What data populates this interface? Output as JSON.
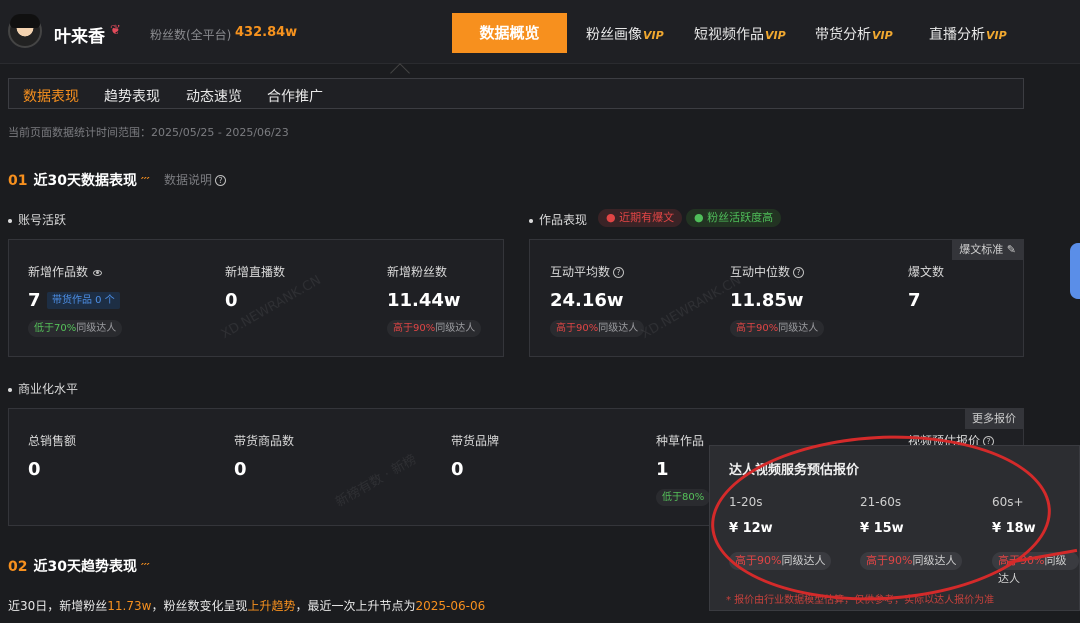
{
  "header": {
    "username": "叶来香",
    "fans_label": "粉丝数(全平台)",
    "fans_value": "432.84w",
    "nav": [
      {
        "label": "数据概览",
        "vip": ""
      },
      {
        "label": "粉丝画像",
        "vip": "VIP"
      },
      {
        "label": "短视频作品",
        "vip": "VIP"
      },
      {
        "label": "带货分析",
        "vip": "VIP"
      },
      {
        "label": "直播分析",
        "vip": "VIP"
      }
    ]
  },
  "tabs": [
    "数据表现",
    "趋势表现",
    "动态速览",
    "合作推广"
  ],
  "date_range": "当前页面数据统计时间范围：2025/05/25 - 2025/06/23",
  "section1": {
    "num": "01",
    "title": "近30天数据表现",
    "note": "数据说明"
  },
  "account": {
    "title": "账号活跃",
    "metrics": [
      {
        "label": "新增作品数",
        "value": "7",
        "tag": "带货作品 0 个",
        "compare_prefix": "低于70%",
        "compare_suffix": "同级达人"
      },
      {
        "label": "新增直播数",
        "value": "0"
      },
      {
        "label": "新增粉丝数",
        "value": "11.44w",
        "compare_prefix": "高于90%",
        "compare_suffix": "同级达人"
      }
    ]
  },
  "works": {
    "title": "作品表现",
    "pill_red": "近期有爆文",
    "pill_green": "粉丝活跃度高",
    "corner": "爆文标准",
    "metrics": [
      {
        "label": "互动平均数",
        "value": "24.16w",
        "compare_prefix": "高于90%",
        "compare_suffix": "同级达人"
      },
      {
        "label": "互动中位数",
        "value": "11.85w",
        "compare_prefix": "高于90%",
        "compare_suffix": "同级达人"
      },
      {
        "label": "爆文数",
        "value": "7"
      }
    ]
  },
  "commerce": {
    "title": "商业化水平",
    "corner": "更多报价",
    "metrics": [
      {
        "label": "总销售额",
        "value": "0"
      },
      {
        "label": "带货商品数",
        "value": "0"
      },
      {
        "label": "带货品牌",
        "value": "0"
      },
      {
        "label": "种草作品",
        "value": "1",
        "compare_prefix": "低于80%"
      },
      {
        "label": "视频预估报价"
      }
    ]
  },
  "section2": {
    "num": "02",
    "title": "近30天趋势表现"
  },
  "trend": {
    "prefix": "近30日，新增粉丝",
    "fans": "11.73w",
    "mid": "，粉丝数变化呈现",
    "trend": "上升趋势",
    "mid2": "，最近一次上升节点为",
    "date": "2025-06-06"
  },
  "popup": {
    "title": "达人视频服务预估报价",
    "columns": [
      {
        "range": "1-20s",
        "price": "¥ 12w",
        "compare_prefix": "高于90%",
        "compare_suffix": "同级达人"
      },
      {
        "range": "21-60s",
        "price": "¥ 15w",
        "compare_prefix": "高于90%",
        "compare_suffix": "同级达人"
      },
      {
        "range": "60s+",
        "price": "¥ 18w",
        "compare_prefix": "高于90%",
        "compare_suffix": "同级达人"
      }
    ],
    "footnote": "* 报价由行业数据模型估算，仅供参考，实际以达人报价为准"
  },
  "watermarks": [
    "XD.NEWRANK.CN",
    "XD.NEWRANK.CN",
    "新榜有数 · 新榜"
  ],
  "colors": {
    "accent": "#f7901e",
    "red": "#e04545",
    "green": "#55c25a",
    "blue": "#4d8fe6"
  }
}
